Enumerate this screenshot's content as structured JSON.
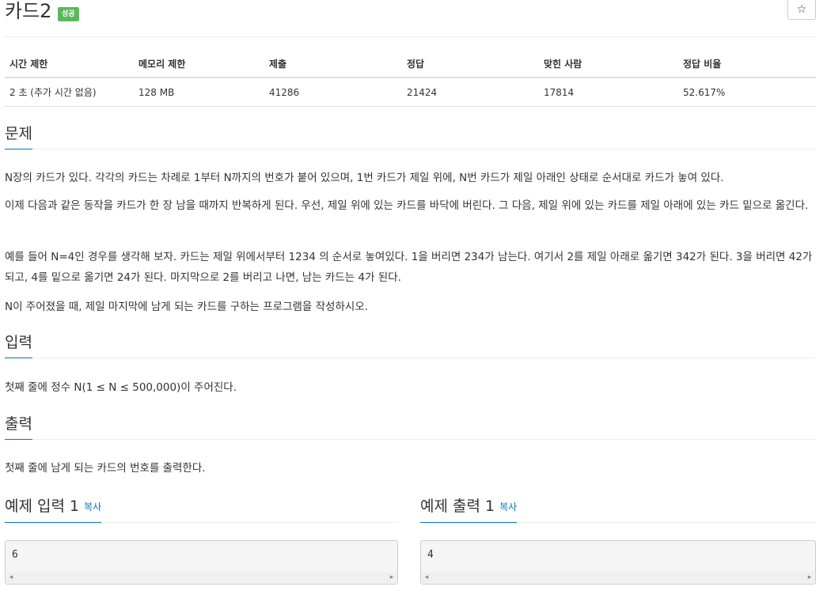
{
  "header": {
    "title": "카드2",
    "badge": "성공",
    "star_icon": "☆"
  },
  "info_table": {
    "headers": [
      "시간 제한",
      "메모리 제한",
      "제출",
      "정답",
      "맞힌 사람",
      "정답 비율"
    ],
    "values": [
      "2 초 (추가 시간 없음)",
      "128 MB",
      "41286",
      "21424",
      "17814",
      "52.617%"
    ]
  },
  "problem": {
    "heading": "문제",
    "paragraphs": [
      "N장의 카드가 있다. 각각의 카드는 차례로 1부터 N까지의 번호가 붙어 있으며, 1번 카드가 제일 위에, N번 카드가 제일 아래인 상태로 순서대로 카드가 놓여 있다.",
      "이제 다음과 같은 동작을 카드가 한 장 남을 때까지 반복하게 된다. 우선, 제일 위에 있는 카드를 바닥에 버린다. 그 다음, 제일 위에 있는 카드를 제일 아래에 있는 카드 밑으로 옮긴다.",
      "예를 들어 N=4인 경우를 생각해 보자. 카드는 제일 위에서부터 1234 의 순서로 놓여있다. 1을 버리면 234가 남는다. 여기서 2를 제일 아래로 옮기면 342가 된다. 3을 버리면 42가 되고, 4를 밑으로 옮기면 24가 된다. 마지막으로 2를 버리고 나면, 남는 카드는 4가 된다.",
      "N이 주어졌을 때, 제일 마지막에 남게 되는 카드를 구하는 프로그램을 작성하시오."
    ]
  },
  "input": {
    "heading": "입력",
    "text": "첫째 줄에 정수 N(1 ≤ N ≤ 500,000)이 주어진다."
  },
  "output": {
    "heading": "출력",
    "text": "첫째 줄에 남게 되는 카드의 번호를 출력한다."
  },
  "samples": {
    "input": {
      "heading": "예제 입력 1",
      "copy": "복사",
      "value": "6"
    },
    "output": {
      "heading": "예제 출력 1",
      "copy": "복사",
      "value": "4"
    }
  },
  "scroll_icons": {
    "left": "◂",
    "right": "▸"
  }
}
